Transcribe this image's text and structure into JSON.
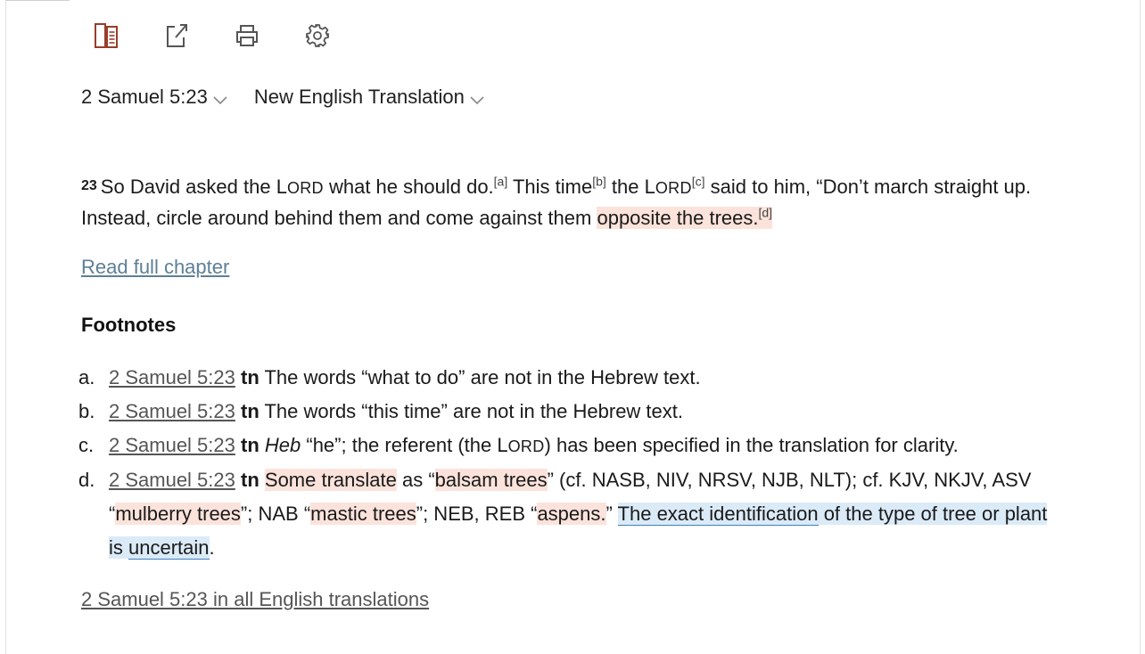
{
  "toolbar": {
    "icons": [
      "parallel-view-icon",
      "open-external-icon",
      "print-icon",
      "settings-gear-icon"
    ],
    "accent": "#9a3d2c"
  },
  "selectors": {
    "reference": "2 Samuel 5:23",
    "translation": "New English Translation"
  },
  "passage": {
    "verse_number": "23",
    "t1": "So David asked the ",
    "lord_L": "L",
    "lord_rest": "ORD",
    "t2": " what he should do.",
    "fn_a": "[a]",
    "t3": " This time",
    "fn_b": "[b]",
    "t4": " the ",
    "fn_c": "[c]",
    "t5": " said to him, “Don’t march straight up. Instead, circle around behind them and come against them ",
    "t6": "opposite the trees.",
    "fn_d": "[d]"
  },
  "read_full_chapter": "Read full chapter",
  "footnotes_heading": "Footnotes",
  "footnotes": {
    "a": {
      "letter": "a.",
      "ref": "2 Samuel 5:23",
      "tn": "tn",
      "text": " The words “what to do” are not in the Hebrew text."
    },
    "b": {
      "letter": "b.",
      "ref": "2 Samuel 5:23",
      "tn": "tn",
      "text": " The words “this time” are not in the Hebrew text."
    },
    "c": {
      "letter": "c.",
      "ref": "2 Samuel 5:23",
      "tn": "tn",
      "heb": "Heb",
      "text1": " “he”; the referent (the ",
      "text2": ") has been specified in the translation for clarity."
    },
    "d": {
      "letter": "d.",
      "ref": "2 Samuel 5:23",
      "tn": "tn",
      "p1": "Some translate",
      "p2": " as “",
      "p3": "balsam trees",
      "p4": "” (cf. NASB, NIV, NRSV, NJB, NLT); cf. KJV, NKJV, ASV “",
      "p5": "mulberry trees",
      "p6": "”; NAB “",
      "p7": "mastic trees",
      "p8": "”; NEB, REB “",
      "p9": "aspens.",
      "p10": "” ",
      "p11": "The exact identification",
      "p12": " of the type of tree or plant is ",
      "p13": "uncertain",
      "p14": "."
    }
  },
  "all_translations_link": "2 Samuel 5:23 in all English translations",
  "colors": {
    "highlight_pink": "#fbe3db",
    "highlight_blue": "#dbeaf7",
    "link_blue_gray": "#5e7f95"
  }
}
